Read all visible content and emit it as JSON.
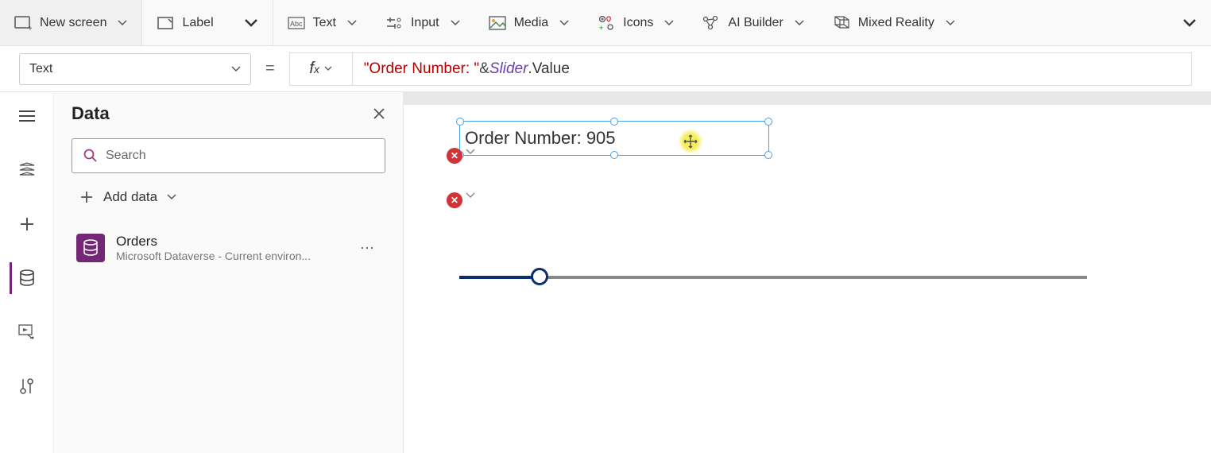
{
  "ribbon": {
    "new_screen": "New screen",
    "label": "Label",
    "text": "Text",
    "input": "Input",
    "media": "Media",
    "icons": "Icons",
    "ai_builder": "AI Builder",
    "mixed_reality": "Mixed Reality"
  },
  "property_selector": {
    "value": "Text"
  },
  "formula": {
    "string_part": "\"Order Number: \"",
    "operator": " & ",
    "variable": "Slider",
    "dot_prop": ".Value"
  },
  "data_panel": {
    "title": "Data",
    "search_placeholder": "Search",
    "add_data": "Add data",
    "items": [
      {
        "name": "Orders",
        "subtitle": "Microsoft Dataverse - Current environ..."
      }
    ]
  },
  "canvas": {
    "label_text": "Order Number: 905",
    "slider_value": 905
  }
}
